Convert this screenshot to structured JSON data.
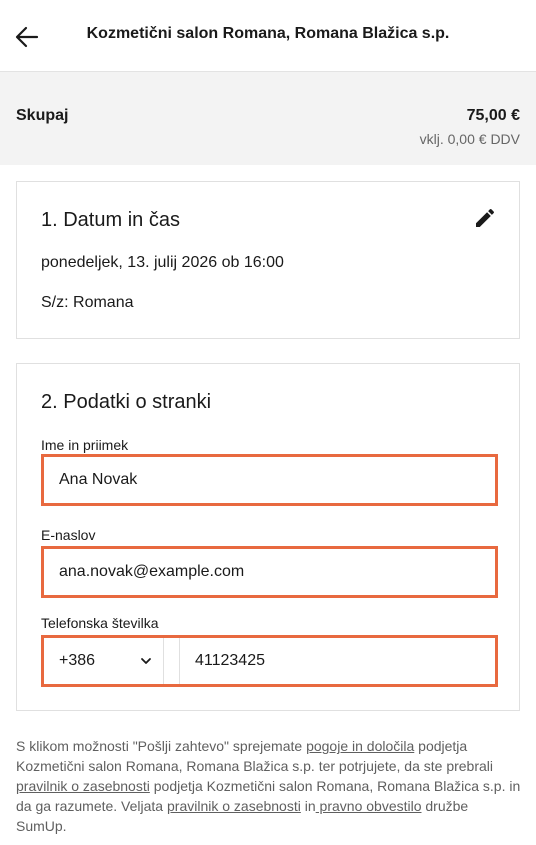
{
  "header": {
    "title": "Kozmetični salon Romana, Romana Blažica s.p.",
    "back_icon": "arrow-left-icon"
  },
  "summary": {
    "label": "Skupaj",
    "amount": "75,00 €",
    "vat": "vklj. 0,00 € DDV"
  },
  "datetime": {
    "title": "1. Datum in čas",
    "date": "ponedeljek, 13. julij 2026 ob 16:00",
    "staff": "S/z: Romana",
    "edit_icon": "pencil-icon"
  },
  "client": {
    "title": "2. Podatki o stranki",
    "name_label": "Ime in priimek",
    "name_value": "Ana Novak",
    "email_label": "E-naslov",
    "email_value": "ana.novak@example.com",
    "phone_label": "Telefonska številka",
    "country_code": "+386",
    "phone_value": "41123425"
  },
  "legal": {
    "t1": "S klikom možnosti \"Pošlji zahtevo\" sprejemate ",
    "link_terms": "pogoje in določila",
    "t2": " podjetja Kozmetični salon Romana, Romana Blažica s.p. ter potrjujete, da ste prebrali ",
    "link_privacy": "pravilnik o zasebnosti",
    "t3": " podjetja Kozmetični salon Romana, Romana Blažica s.p. in da ga razumete. Veljata ",
    "link_privacy2": "pravilnik o zasebnosti",
    "t4": " in",
    "link_legal": " pravno obvestilo",
    "t5": " družbe SumUp."
  },
  "colors": {
    "accent": "#e8693f",
    "summary_bg": "#f3f3f3"
  }
}
